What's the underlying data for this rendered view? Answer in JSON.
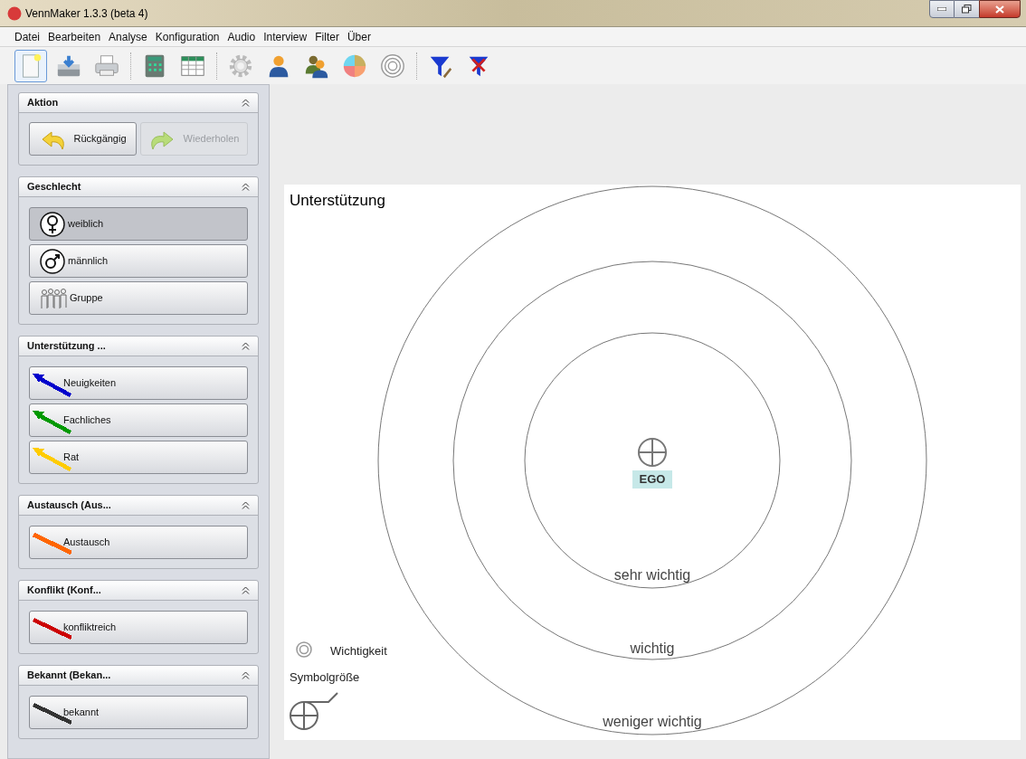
{
  "window": {
    "title": "VennMaker 1.3.3 (beta 4)"
  },
  "menu": [
    "Datei",
    "Bearbeiten",
    "Analyse",
    "Konfiguration",
    "Audio",
    "Interview",
    "Filter",
    "Über"
  ],
  "toolbar": [
    {
      "kind": "new",
      "focused": true
    },
    {
      "kind": "save",
      "focused": false
    },
    {
      "kind": "print",
      "focused": false
    },
    {
      "kind": "calculator",
      "focused": false
    },
    {
      "kind": "table",
      "focused": false
    },
    {
      "kind": "gear",
      "focused": false
    },
    {
      "kind": "person",
      "focused": false
    },
    {
      "kind": "people",
      "focused": false
    },
    {
      "kind": "pie",
      "focused": false
    },
    {
      "kind": "rings",
      "focused": false
    },
    {
      "kind": "filter-edit",
      "focused": false
    },
    {
      "kind": "filter-remove",
      "focused": false
    }
  ],
  "sections": [
    {
      "title": "Aktion",
      "buttons": [
        {
          "kind": "undo",
          "label": "Rückgängig",
          "disabled": false
        },
        {
          "kind": "redo",
          "label": "Wiederholen",
          "disabled": true
        }
      ]
    },
    {
      "title": "Geschlecht",
      "buttons": [
        {
          "kind": "female",
          "label": "weiblich",
          "disabled": false,
          "selected": true
        },
        {
          "kind": "male",
          "label": "männlich",
          "disabled": false,
          "selected": false
        },
        {
          "kind": "group",
          "label": "Gruppe",
          "disabled": false,
          "selected": false
        }
      ]
    },
    {
      "title": "Unterstützung ...",
      "buttons": [
        {
          "kind": "arrow",
          "label": "Neuigkeiten",
          "color": "#0000cc",
          "disabled": false,
          "selected": false
        },
        {
          "kind": "arrow",
          "label": "Fachliches",
          "color": "#009900",
          "disabled": false,
          "selected": false
        },
        {
          "kind": "arrow",
          "label": "Rat",
          "color": "#ffcc00",
          "disabled": false,
          "selected": false
        }
      ]
    },
    {
      "title": "Austausch (Aus...",
      "buttons": [
        {
          "kind": "thick-line",
          "label": "Austausch",
          "color": "#ff6600",
          "disabled": false,
          "selected": false
        }
      ]
    },
    {
      "title": "Konflikt (Konf...",
      "buttons": [
        {
          "kind": "line",
          "label": "konfliktreich",
          "color": "#cc0000",
          "disabled": false,
          "selected": false
        }
      ]
    },
    {
      "title": "Bekannt (Bekan...",
      "buttons": [
        {
          "kind": "line",
          "label": "bekannt",
          "color": "#333333",
          "disabled": false,
          "selected": false
        }
      ]
    }
  ],
  "canvas": {
    "title": "Unterstützung",
    "ego": "EGO",
    "rings": [
      {
        "label": "sehr wichtig"
      },
      {
        "label": "wichtig"
      },
      {
        "label": "weniger wichtig"
      }
    ],
    "legend": {
      "importance": "Wichtigkeit",
      "symbol_size": "Symbolgröße"
    }
  }
}
